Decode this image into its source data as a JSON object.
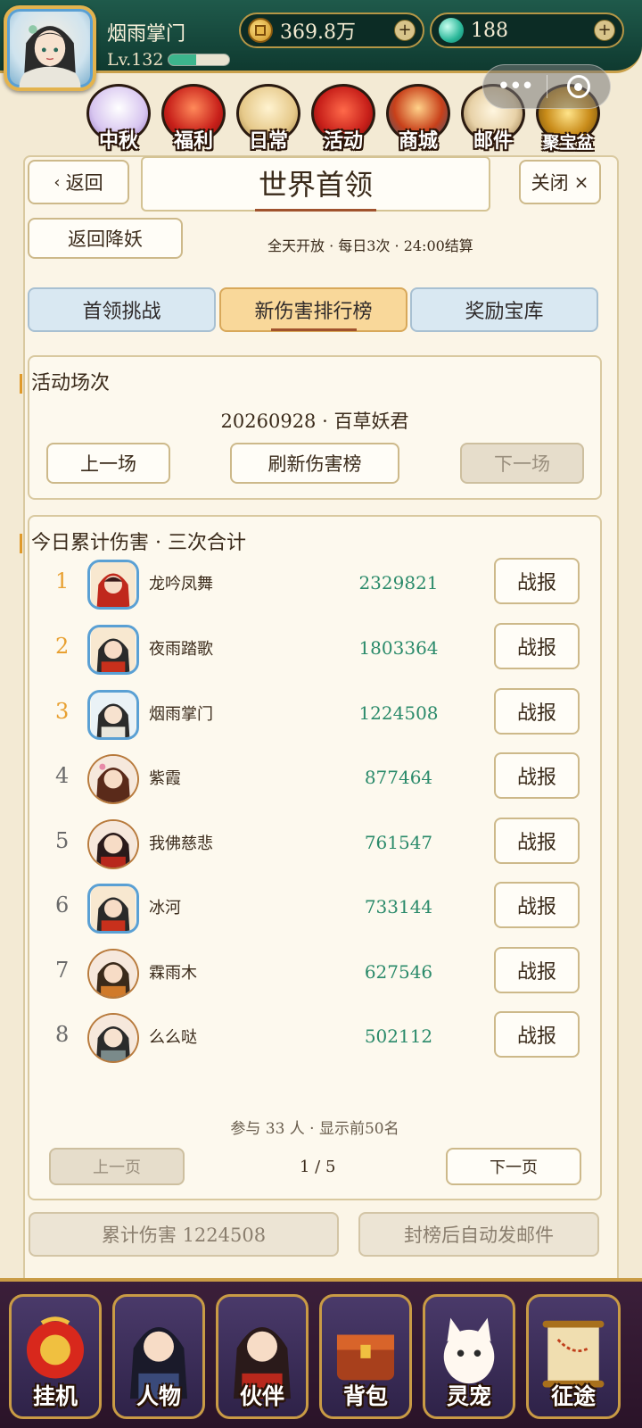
{
  "header": {
    "player_name": "烟雨掌门",
    "level": "Lv.132",
    "level_progress": 0.45,
    "coins": "369.8万",
    "jade": "188"
  },
  "top_icons": [
    {
      "label": "中秋",
      "icon": "rabbit-icon"
    },
    {
      "label": "福利",
      "icon": "gift-box-icon"
    },
    {
      "label": "日常",
      "icon": "scroll-icon"
    },
    {
      "label": "活动",
      "icon": "lucky-bag-icon"
    },
    {
      "label": "商城",
      "icon": "shop-icon"
    },
    {
      "label": "邮件",
      "icon": "mail-icon"
    },
    {
      "label": "聚宝盆",
      "icon": "treasure-bowl-icon"
    }
  ],
  "panel": {
    "back": "返回",
    "title": "世界首领",
    "close": "关闭",
    "back_to": "返回降妖",
    "schedule": "全天开放 · 每日3次 · 24:00结算"
  },
  "tabs": [
    "首领挑战",
    "新伤害排行榜",
    "奖励宝库"
  ],
  "session": {
    "title": "活动场次",
    "match": "20260928 · 百草妖君",
    "prev": "上一场",
    "refresh": "刷新伤害榜",
    "next": "下一场"
  },
  "ranking": {
    "title": "今日累计伤害 · 三次合计",
    "button_label": "战报",
    "rows": [
      {
        "rank": "1",
        "name": "龙吟凤舞",
        "damage": "2329821"
      },
      {
        "rank": "2",
        "name": "夜雨踏歌",
        "damage": "1803364"
      },
      {
        "rank": "3",
        "name": "烟雨掌门",
        "damage": "1224508"
      },
      {
        "rank": "4",
        "name": "紫霞",
        "damage": "877464"
      },
      {
        "rank": "5",
        "name": "我佛慈悲",
        "damage": "761547"
      },
      {
        "rank": "6",
        "name": "冰河",
        "damage": "733144"
      },
      {
        "rank": "7",
        "name": "霖雨木",
        "damage": "627546"
      },
      {
        "rank": "8",
        "name": "么么哒",
        "damage": "502112"
      }
    ],
    "footnote": "参与 33 人 · 显示前50名",
    "prev_page": "上一页",
    "page": "1 / 5",
    "next_page": "下一页"
  },
  "summary": {
    "my_damage": "累计伤害 1224508",
    "auto_mail": "封榜后自动发邮件"
  },
  "bottom_nav": [
    {
      "label": "挂机",
      "icon": "lucky-bag-icon"
    },
    {
      "label": "人物",
      "icon": "character-icon"
    },
    {
      "label": "伙伴",
      "icon": "partner-icon"
    },
    {
      "label": "背包",
      "icon": "treasure-chest-icon"
    },
    {
      "label": "灵宠",
      "icon": "fox-pet-icon"
    },
    {
      "label": "征途",
      "icon": "map-scroll-icon"
    }
  ]
}
